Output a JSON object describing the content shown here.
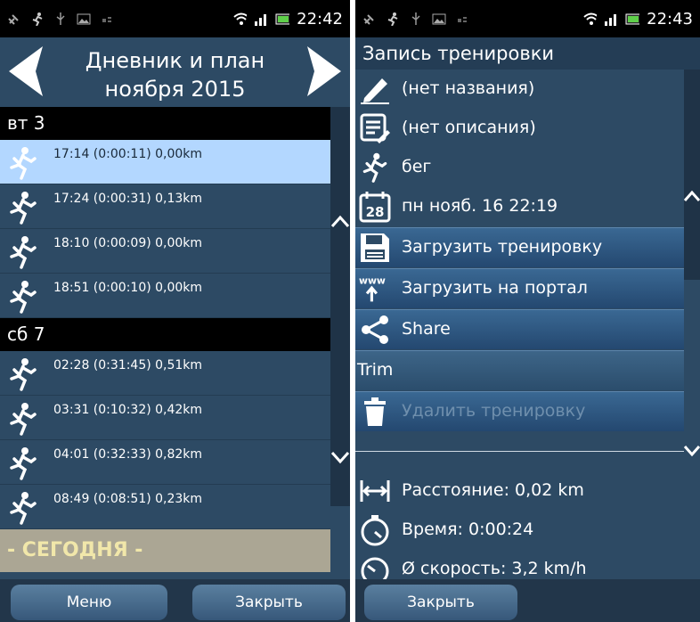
{
  "left": {
    "status": {
      "time": "22:42"
    },
    "header": {
      "title_line1": "Дневник и  план",
      "title_line2": "ноября 2015"
    },
    "days": [
      {
        "label": "вт 3",
        "entries": [
          "17:14 (0:00:11) 0,00km",
          "17:24 (0:00:31) 0,13km",
          "18:10 (0:00:09) 0,00km",
          "18:51 (0:00:10) 0,00km"
        ]
      },
      {
        "label": "сб 7",
        "entries": [
          "02:28 (0:31:45) 0,51km",
          "03:31 (0:10:32) 0,42km",
          "04:01 (0:32:33) 0,82km",
          "08:49 (0:08:51) 0,23km"
        ]
      }
    ],
    "today_label": "- СЕГОДНЯ -",
    "footer": {
      "menu": "Меню",
      "close": "Закрыть"
    }
  },
  "right": {
    "status": {
      "time": "22:43"
    },
    "title": "Запись тренировки",
    "rows": {
      "name": "(нет названия)",
      "description": "(нет описания)",
      "sport": "бег",
      "date_icon_text": "28",
      "date": "пн нояб. 16 22:19",
      "upload": "Загрузить тренировку",
      "upload_portal": "Загрузить на портал",
      "www": "www",
      "share": "Share",
      "trim": "Trim",
      "delete": "Удалить тренировку"
    },
    "stats": {
      "distance": "Расстояние: 0,02 km",
      "time": "Время: 0:00:24",
      "speed": "Ø скорость: 3,2 km/h"
    },
    "footer": {
      "close": "Закрыть"
    }
  },
  "colors": {
    "panel": "#2d4a64",
    "selected": "#b3d7ff",
    "today_bar": "#aba694",
    "today_text": "#f1e7aa"
  }
}
